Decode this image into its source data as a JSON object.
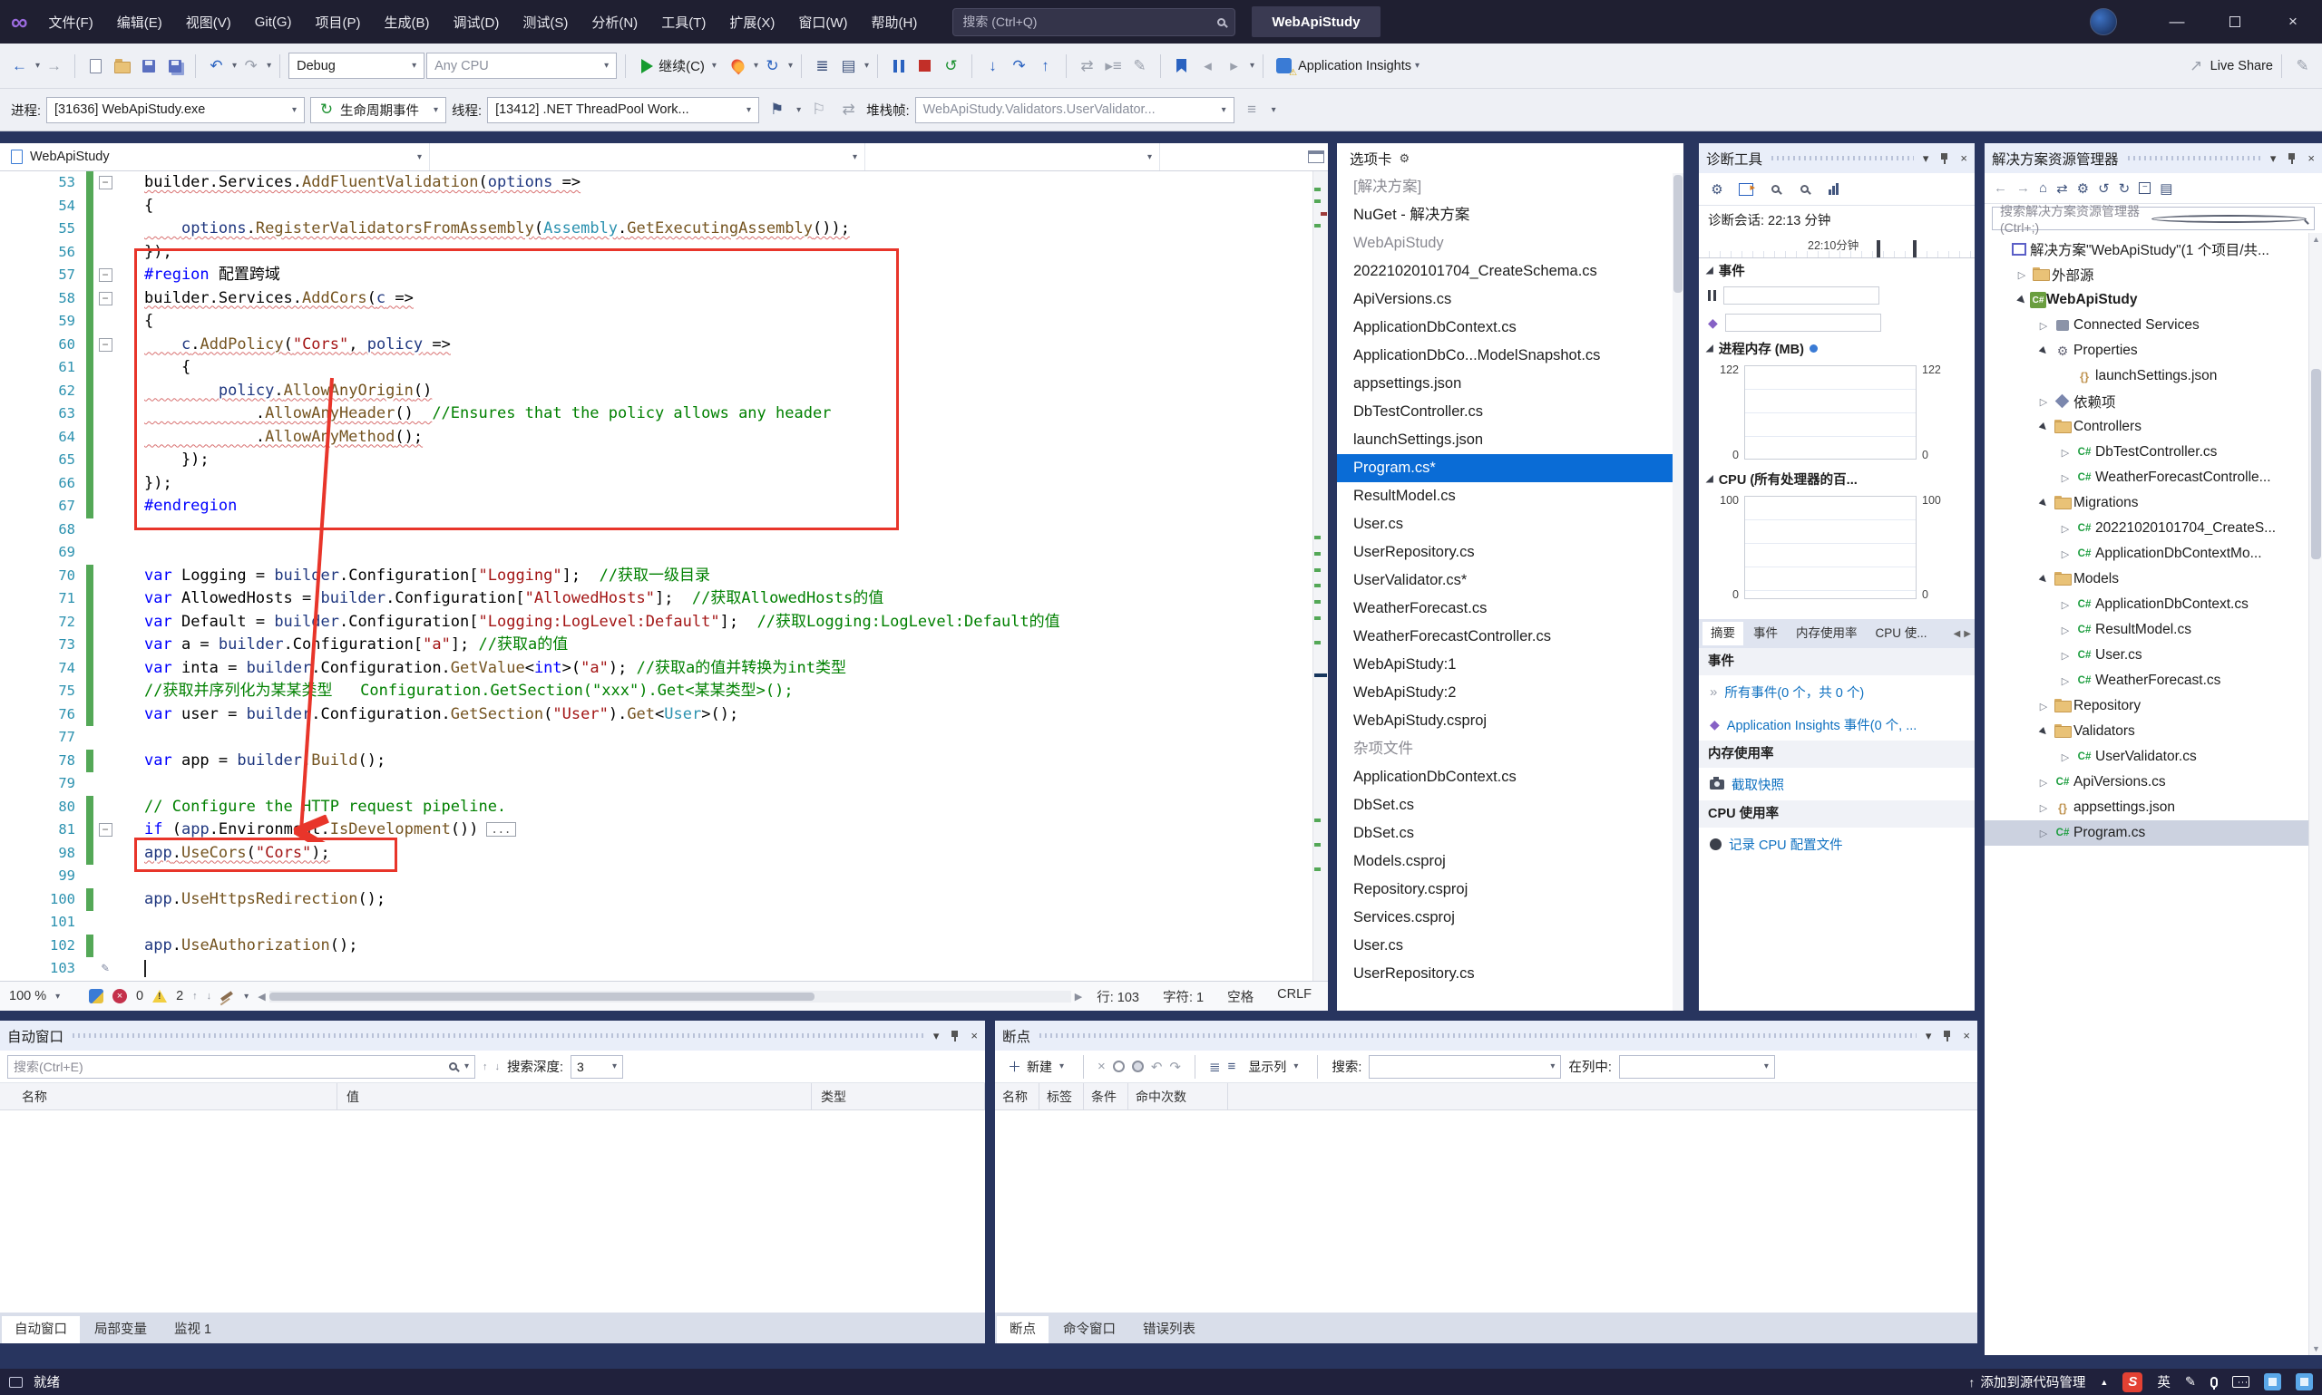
{
  "colors": {
    "accent": "#0a6cd6",
    "dock_background": "#28355f",
    "titlebar_background": "#1f1f31",
    "selected_item_blue": "#0a6cd6",
    "annotation_red": "#e8352a",
    "link_blue": "#0e70c0",
    "change_bar_green": "#54a857"
  },
  "titlebar": {
    "menus": [
      "文件(F)",
      "编辑(E)",
      "视图(V)",
      "Git(G)",
      "项目(P)",
      "生成(B)",
      "调试(D)",
      "测试(S)",
      "分析(N)",
      "工具(T)",
      "扩展(X)",
      "窗口(W)",
      "帮助(H)"
    ],
    "search_placeholder": "搜索 (Ctrl+Q)",
    "solution_name": "WebApiStudy"
  },
  "toolbar": {
    "config_combo": "Debug",
    "platform_combo": "Any CPU",
    "continue_label": "继续(C)",
    "app_insights_label": "Application Insights",
    "live_share_label": "Live Share"
  },
  "debug_toolbar": {
    "process_label": "进程:",
    "process_value": "[31636] WebApiStudy.exe",
    "lifecycle_label": "生命周期事件",
    "thread_label": "线程:",
    "thread_value": "[13412] .NET ThreadPool Work...",
    "stack_label": "堆栈帧:",
    "stack_value": "WebApiStudy.Validators.UserValidator..."
  },
  "editor": {
    "breadcrumb_project": "WebApiStudy",
    "zoom": "100 %",
    "error_count": "0",
    "warning_count": "2",
    "line_label": "行: 103",
    "char_label": "字符: 1",
    "space_label": "空格",
    "eol_label": "CRLF",
    "code_lines": [
      {
        "n": 53,
        "fold": true,
        "chg": "g",
        "sq": true,
        "segs": [
          [
            "p",
            "builder.Services."
          ],
          [
            "m",
            "AddFluentValidation"
          ],
          [
            "p",
            "("
          ],
          [
            "v",
            "options"
          ],
          [
            "p",
            " =>"
          ]
        ]
      },
      {
        "n": 54,
        "chg": "g",
        "segs": [
          [
            "p",
            "{"
          ]
        ]
      },
      {
        "n": 55,
        "chg": "g",
        "sq": true,
        "segs": [
          [
            "p",
            "    "
          ],
          [
            "v",
            "options"
          ],
          [
            "p",
            "."
          ],
          [
            "m",
            "RegisterValidatorsFromAssembly"
          ],
          [
            "p",
            "("
          ],
          [
            "t",
            "Assembly"
          ],
          [
            "p",
            "."
          ],
          [
            "m",
            "GetExecutingAssembly"
          ],
          [
            "p",
            "());"
          ]
        ]
      },
      {
        "n": 56,
        "chg": "g",
        "segs": [
          [
            "p",
            "});"
          ]
        ]
      },
      {
        "n": 57,
        "fold": true,
        "chg": "g",
        "segs": [
          [
            "k",
            "#region"
          ],
          [
            "p",
            " 配置跨域"
          ]
        ]
      },
      {
        "n": 58,
        "fold": true,
        "chg": "g",
        "sq": true,
        "segs": [
          [
            "p",
            "builder.Services."
          ],
          [
            "m",
            "AddCors"
          ],
          [
            "p",
            "("
          ],
          [
            "v",
            "c"
          ],
          [
            "p",
            " =>"
          ]
        ]
      },
      {
        "n": 59,
        "chg": "g",
        "segs": [
          [
            "p",
            "{"
          ]
        ]
      },
      {
        "n": 60,
        "fold": true,
        "chg": "g",
        "sq": true,
        "segs": [
          [
            "p",
            "    "
          ],
          [
            "v",
            "c"
          ],
          [
            "p",
            "."
          ],
          [
            "m",
            "AddPolicy"
          ],
          [
            "p",
            "("
          ],
          [
            "s",
            "\"Cors\""
          ],
          [
            "p",
            ", "
          ],
          [
            "v",
            "policy"
          ],
          [
            "p",
            " =>"
          ]
        ]
      },
      {
        "n": 61,
        "chg": "g",
        "segs": [
          [
            "p",
            "    {"
          ]
        ]
      },
      {
        "n": 62,
        "chg": "g",
        "sq": true,
        "segs": [
          [
            "p",
            "        "
          ],
          [
            "v",
            "policy"
          ],
          [
            "p",
            "."
          ],
          [
            "m",
            "AllowAnyOrigin"
          ],
          [
            "p",
            "()"
          ]
        ]
      },
      {
        "n": 63,
        "chg": "g",
        "sq": true,
        "segs": [
          [
            "p",
            "            ."
          ],
          [
            "m",
            "AllowAnyHeader"
          ],
          [
            "p",
            "()  "
          ],
          [
            "c",
            "//Ensures that the policy allows any header"
          ]
        ]
      },
      {
        "n": 64,
        "chg": "g",
        "sq": true,
        "segs": [
          [
            "p",
            "            ."
          ],
          [
            "m",
            "AllowAnyMethod"
          ],
          [
            "p",
            "();"
          ]
        ]
      },
      {
        "n": 65,
        "chg": "g",
        "segs": [
          [
            "p",
            "    });"
          ]
        ]
      },
      {
        "n": 66,
        "chg": "g",
        "segs": [
          [
            "p",
            "});"
          ]
        ]
      },
      {
        "n": 67,
        "chg": "g",
        "segs": [
          [
            "k",
            "#endregion"
          ]
        ]
      },
      {
        "n": 68,
        "segs": []
      },
      {
        "n": 69,
        "segs": []
      },
      {
        "n": 70,
        "chg": "g",
        "segs": [
          [
            "k",
            "var"
          ],
          [
            "p",
            " Logging = "
          ],
          [
            "v",
            "builder"
          ],
          [
            "p",
            ".Configuration["
          ],
          [
            "s",
            "\"Logging\""
          ],
          [
            "p",
            "];  "
          ],
          [
            "c",
            "//获取一级目录"
          ]
        ]
      },
      {
        "n": 71,
        "chg": "g",
        "segs": [
          [
            "k",
            "var"
          ],
          [
            "p",
            " AllowedHosts = "
          ],
          [
            "v",
            "builder"
          ],
          [
            "p",
            ".Configuration["
          ],
          [
            "s",
            "\"AllowedHosts\""
          ],
          [
            "p",
            "];  "
          ],
          [
            "c",
            "//获取AllowedHosts的值"
          ]
        ]
      },
      {
        "n": 72,
        "chg": "g",
        "segs": [
          [
            "k",
            "var"
          ],
          [
            "p",
            " Default = "
          ],
          [
            "v",
            "builder"
          ],
          [
            "p",
            ".Configuration["
          ],
          [
            "s",
            "\"Logging:LogLevel:Default\""
          ],
          [
            "p",
            "];  "
          ],
          [
            "c",
            "//获取Logging:LogLevel:Default的值"
          ]
        ]
      },
      {
        "n": 73,
        "chg": "g",
        "segs": [
          [
            "k",
            "var"
          ],
          [
            "p",
            " a = "
          ],
          [
            "v",
            "builder"
          ],
          [
            "p",
            ".Configuration["
          ],
          [
            "s",
            "\"a\""
          ],
          [
            "p",
            "]; "
          ],
          [
            "c",
            "//获取a的值"
          ]
        ]
      },
      {
        "n": 74,
        "chg": "g",
        "segs": [
          [
            "k",
            "var"
          ],
          [
            "p",
            " inta = "
          ],
          [
            "v",
            "builder"
          ],
          [
            "p",
            ".Configuration."
          ],
          [
            "m",
            "GetValue"
          ],
          [
            "p",
            "<"
          ],
          [
            "k",
            "int"
          ],
          [
            "p",
            ">("
          ],
          [
            "s",
            "\"a\""
          ],
          [
            "p",
            "); "
          ],
          [
            "c",
            "//获取a的值并转换为int类型"
          ]
        ]
      },
      {
        "n": 75,
        "chg": "g",
        "segs": [
          [
            "c",
            "//获取并序列化为某某类型   Configuration.GetSection(\"xxx\").Get<某某类型>();"
          ]
        ]
      },
      {
        "n": 76,
        "chg": "g",
        "segs": [
          [
            "k",
            "var"
          ],
          [
            "p",
            " user = "
          ],
          [
            "v",
            "builder"
          ],
          [
            "p",
            ".Configuration."
          ],
          [
            "m",
            "GetSection"
          ],
          [
            "p",
            "("
          ],
          [
            "s",
            "\"User\""
          ],
          [
            "p",
            ")."
          ],
          [
            "m",
            "Get"
          ],
          [
            "p",
            "<"
          ],
          [
            "t",
            "User"
          ],
          [
            "p",
            ">();"
          ]
        ]
      },
      {
        "n": 77,
        "segs": []
      },
      {
        "n": 78,
        "chg": "g",
        "segs": [
          [
            "k",
            "var"
          ],
          [
            "p",
            " app = "
          ],
          [
            "v",
            "builder"
          ],
          [
            "p",
            "."
          ],
          [
            "m",
            "Build"
          ],
          [
            "p",
            "();"
          ]
        ]
      },
      {
        "n": 79,
        "segs": []
      },
      {
        "n": 80,
        "chg": "g",
        "segs": [
          [
            "c",
            "// Configure the HTTP request pipeline."
          ]
        ]
      },
      {
        "n": 81,
        "fold": true,
        "chg": "g",
        "segs": [
          [
            "k",
            "if"
          ],
          [
            "p",
            " ("
          ],
          [
            "v",
            "app"
          ],
          [
            "p",
            ".Environment."
          ],
          [
            "m",
            "IsDevelopment"
          ],
          [
            "p",
            "())"
          ],
          [
            "x",
            "..."
          ]
        ]
      },
      {
        "n": 98,
        "chg": "g",
        "sq": true,
        "segs": [
          [
            "v",
            "app"
          ],
          [
            "p",
            "."
          ],
          [
            "m",
            "UseCors"
          ],
          [
            "p",
            "("
          ],
          [
            "s",
            "\"Cors\""
          ],
          [
            "p",
            ");"
          ]
        ]
      },
      {
        "n": 99,
        "segs": []
      },
      {
        "n": 100,
        "chg": "g",
        "segs": [
          [
            "v",
            "app"
          ],
          [
            "p",
            "."
          ],
          [
            "m",
            "UseHttpsRedirection"
          ],
          [
            "p",
            "();"
          ]
        ]
      },
      {
        "n": 101,
        "segs": []
      },
      {
        "n": 102,
        "chg": "g",
        "segs": [
          [
            "v",
            "app"
          ],
          [
            "p",
            "."
          ],
          [
            "m",
            "UseAuthorization"
          ],
          [
            "p",
            "();"
          ]
        ]
      },
      {
        "n": 103,
        "caret": true,
        "pencil": true,
        "segs": []
      }
    ]
  },
  "tabs_panel": {
    "title": "选项卡",
    "items": [
      {
        "label": "[解决方案]",
        "type": "section"
      },
      {
        "label": "NuGet - 解决方案",
        "type": "item"
      },
      {
        "label": "WebApiStudy",
        "type": "section"
      },
      {
        "label": "20221020101704_CreateSchema.cs",
        "type": "item"
      },
      {
        "label": "ApiVersions.cs",
        "type": "item"
      },
      {
        "label": "ApplicationDbContext.cs",
        "type": "item"
      },
      {
        "label": "ApplicationDbCo...ModelSnapshot.cs",
        "type": "item"
      },
      {
        "label": "appsettings.json",
        "type": "item"
      },
      {
        "label": "DbTestController.cs",
        "type": "item"
      },
      {
        "label": "launchSettings.json",
        "type": "item"
      },
      {
        "label": "Program.cs*",
        "type": "item",
        "selected": true
      },
      {
        "label": "ResultModel.cs",
        "type": "item"
      },
      {
        "label": "User.cs",
        "type": "item"
      },
      {
        "label": "UserRepository.cs",
        "type": "item"
      },
      {
        "label": "UserValidator.cs*",
        "type": "item"
      },
      {
        "label": "WeatherForecast.cs",
        "type": "item"
      },
      {
        "label": "WeatherForecastController.cs",
        "type": "item"
      },
      {
        "label": "WebApiStudy:1",
        "type": "item"
      },
      {
        "label": "WebApiStudy:2",
        "type": "item"
      },
      {
        "label": "WebApiStudy.csproj",
        "type": "item"
      },
      {
        "label": "杂项文件",
        "type": "section"
      },
      {
        "label": "ApplicationDbContext.cs",
        "type": "item"
      },
      {
        "label": "DbSet.cs",
        "type": "item"
      },
      {
        "label": "DbSet.cs",
        "type": "item"
      },
      {
        "label": "Models.csproj",
        "type": "item"
      },
      {
        "label": "Repository.csproj",
        "type": "item"
      },
      {
        "label": "Services.csproj",
        "type": "item"
      },
      {
        "label": "User.cs",
        "type": "item"
      },
      {
        "label": "UserRepository.cs",
        "type": "item"
      }
    ]
  },
  "diagnostics": {
    "title": "诊断工具",
    "session_label": "诊断会话: 22:13 分钟",
    "timeline_label": "22:10分钟",
    "events_section": "事件",
    "memory_section": "进程内存 (MB)",
    "cpu_section": "CPU (所有处理器的百...",
    "memory_axis": {
      "top": "122",
      "bottom": "0"
    },
    "cpu_axis": {
      "top": "100",
      "bottom": "0"
    },
    "tabs": [
      "摘要",
      "事件",
      "内存使用率",
      "CPU 使..."
    ],
    "active_tab": "摘要",
    "summary": {
      "events_heading": "事件",
      "all_events_link": "所有事件(0 个，共 0 个)",
      "ai_events_link": "Application Insights 事件(0 个, ...",
      "memory_heading": "内存使用率",
      "snapshot_link": "截取快照",
      "cpu_heading": "CPU 使用率",
      "record_link": "记录 CPU 配置文件"
    }
  },
  "solution_explorer": {
    "title": "解决方案资源管理器",
    "search_placeholder": "搜索解决方案资源管理器(Ctrl+;)",
    "items": [
      {
        "label": "解决方案\"WebApiStudy\"(1 个项目/共...",
        "icon": "solution",
        "indent": 0,
        "arrow": ""
      },
      {
        "label": "外部源",
        "icon": "folder",
        "indent": 1,
        "arrow": "collapsed"
      },
      {
        "label": "WebApiStudy",
        "icon": "project",
        "indent": 1,
        "arrow": "expanded",
        "bold": true
      },
      {
        "label": "Connected Services",
        "icon": "plug",
        "indent": 2,
        "arrow": "collapsed"
      },
      {
        "label": "Properties",
        "icon": "wrench",
        "indent": 2,
        "arrow": "expanded"
      },
      {
        "label": "launchSettings.json",
        "icon": "json",
        "indent": 3,
        "arrow": ""
      },
      {
        "label": "依赖项",
        "icon": "deps",
        "indent": 2,
        "arrow": "collapsed"
      },
      {
        "label": "Controllers",
        "icon": "folder",
        "indent": 2,
        "arrow": "expanded"
      },
      {
        "label": "DbTestController.cs",
        "icon": "cs",
        "indent": 3,
        "arrow": "collapsed"
      },
      {
        "label": "WeatherForecastControlle...",
        "icon": "cs",
        "indent": 3,
        "arrow": "collapsed"
      },
      {
        "label": "Migrations",
        "icon": "folder",
        "indent": 2,
        "arrow": "expanded"
      },
      {
        "label": "20221020101704_CreateS...",
        "icon": "cs",
        "indent": 3,
        "arrow": "collapsed"
      },
      {
        "label": "ApplicationDbContextMo...",
        "icon": "cs",
        "indent": 3,
        "arrow": "collapsed"
      },
      {
        "label": "Models",
        "icon": "folder",
        "indent": 2,
        "arrow": "expanded"
      },
      {
        "label": "ApplicationDbContext.cs",
        "icon": "cs",
        "indent": 3,
        "arrow": "collapsed"
      },
      {
        "label": "ResultModel.cs",
        "icon": "cs",
        "indent": 3,
        "arrow": "collapsed"
      },
      {
        "label": "User.cs",
        "icon": "cs",
        "indent": 3,
        "arrow": "collapsed"
      },
      {
        "label": "WeatherForecast.cs",
        "icon": "cs",
        "indent": 3,
        "arrow": "collapsed"
      },
      {
        "label": "Repository",
        "icon": "folder",
        "indent": 2,
        "arrow": "collapsed"
      },
      {
        "label": "Validators",
        "icon": "folder",
        "indent": 2,
        "arrow": "expanded"
      },
      {
        "label": "UserValidator.cs",
        "icon": "cs",
        "indent": 3,
        "arrow": "collapsed"
      },
      {
        "label": "ApiVersions.cs",
        "icon": "cs",
        "indent": 2,
        "arrow": "collapsed"
      },
      {
        "label": "appsettings.json",
        "icon": "json",
        "indent": 2,
        "arrow": "collapsed"
      },
      {
        "label": "Program.cs",
        "icon": "cs",
        "indent": 2,
        "arrow": "collapsed",
        "selected": true
      }
    ]
  },
  "autos": {
    "title": "自动窗口",
    "search_placeholder": "搜索(Ctrl+E)",
    "depth_label": "搜索深度:",
    "depth_value": "3",
    "columns": [
      "名称",
      "值",
      "类型"
    ],
    "tabs": [
      "自动窗口",
      "局部变量",
      "监视 1"
    ],
    "active_tab": "自动窗口"
  },
  "breakpoints": {
    "title": "断点",
    "new_label": "新建",
    "show_columns_label": "显示列",
    "search_label": "搜索:",
    "in_column_label": "在列中:",
    "columns": [
      "名称",
      "标签",
      "条件",
      "命中次数"
    ],
    "tabs": [
      "断点",
      "命令窗口",
      "错误列表"
    ],
    "active_tab": "断点"
  },
  "statusbar": {
    "ready": "就绪",
    "source_control": "添加到源代码管理",
    "sogou": "S",
    "ime_mode": "英"
  }
}
